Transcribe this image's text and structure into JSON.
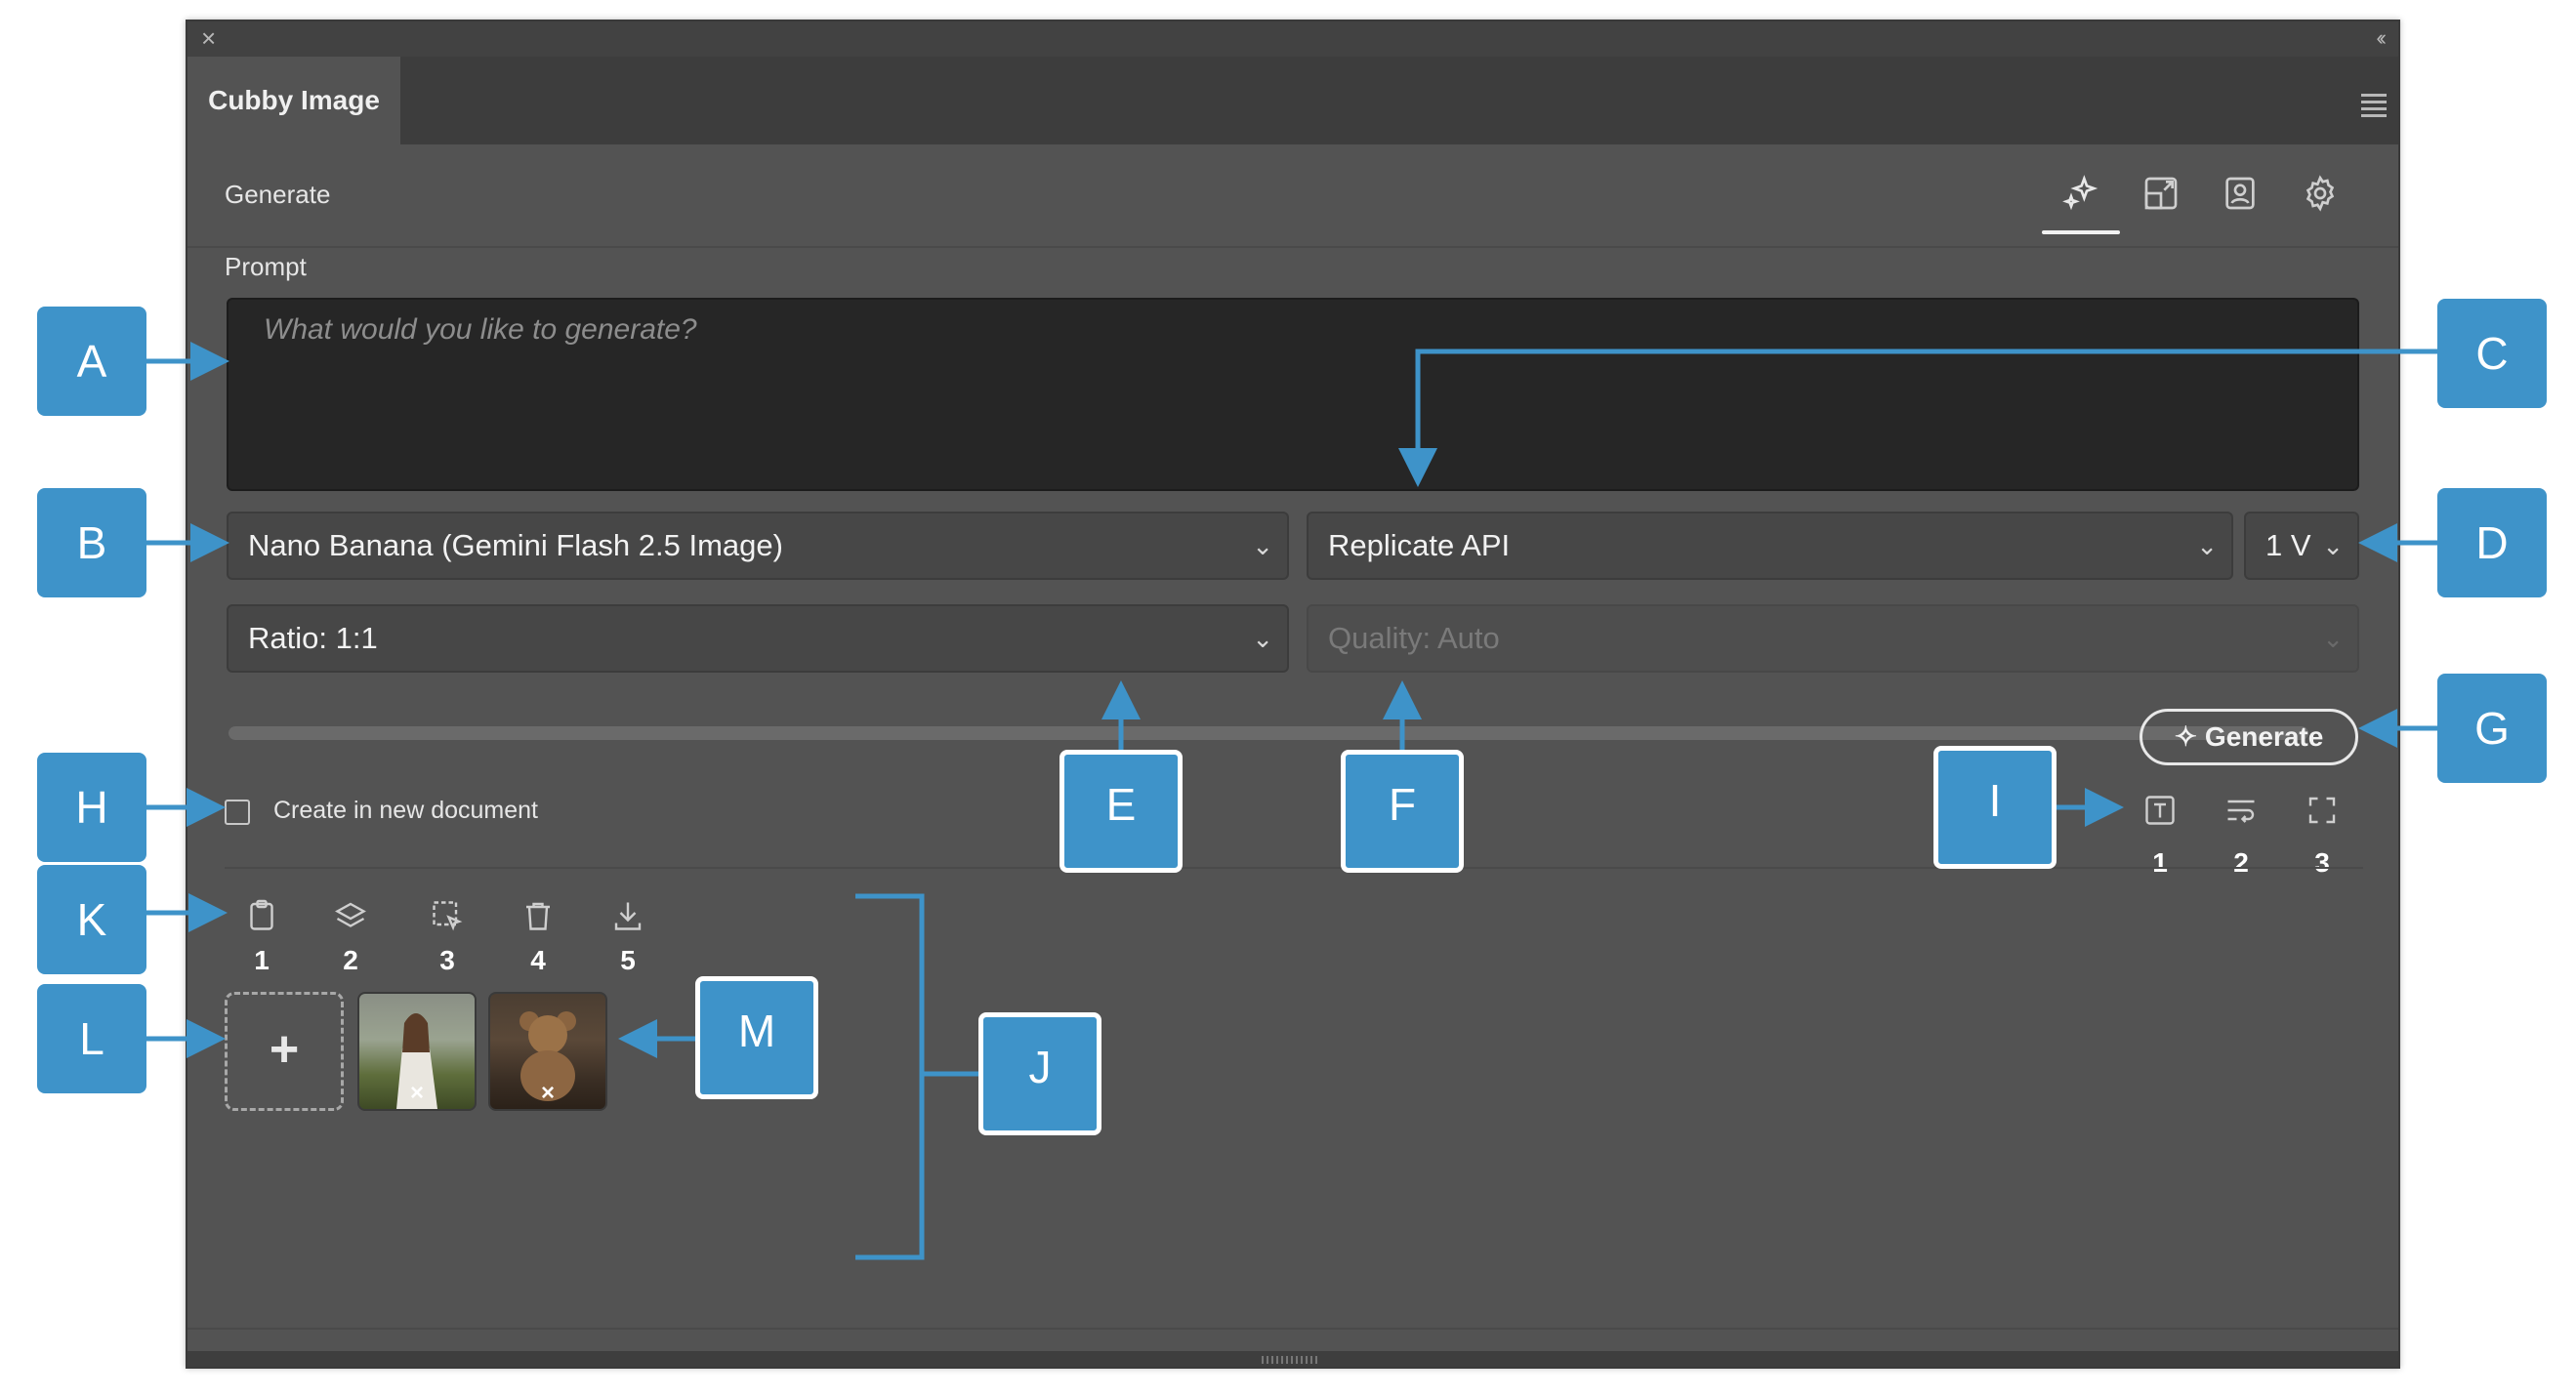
{
  "panel": {
    "close_glyph": "×",
    "collapse_glyph": "‹‹",
    "tab_label": "Cubby Image",
    "section_title": "Generate",
    "header_icons": [
      "sparkle-icon",
      "image-resize-icon",
      "portrait-icon",
      "gear-icon"
    ]
  },
  "prompt": {
    "label": "Prompt",
    "placeholder": "What would you like to generate?"
  },
  "selects": {
    "model": "Nano Banana (Gemini Flash 2.5 Image)",
    "provider": "Replicate API",
    "count": "1 V",
    "ratio": "Ratio: 1:1",
    "quality": "Quality: Auto"
  },
  "generate_button": {
    "label": "Generate",
    "icon": "sparkle-icon"
  },
  "new_document": {
    "label": "Create in new document",
    "checked": false
  },
  "output_icons": {
    "icons": [
      "text-box-icon",
      "wrap-text-icon",
      "fullscreen-icon"
    ],
    "numbers": [
      "1",
      "2",
      "3"
    ]
  },
  "toolbar": {
    "icons": [
      "clipboard-icon",
      "layers-icon",
      "select-region-icon",
      "trash-icon",
      "download-icon"
    ],
    "numbers": [
      "1",
      "2",
      "3",
      "4",
      "5"
    ]
  },
  "reference_images": {
    "add_glyph": "+",
    "remove_glyph": "×",
    "thumbnails": [
      "woman-in-field-thumbnail",
      "teddy-bear-thumbnail"
    ]
  },
  "callouts": [
    "A",
    "B",
    "C",
    "D",
    "E",
    "F",
    "G",
    "H",
    "I",
    "J",
    "K",
    "L",
    "M"
  ],
  "colors": {
    "callout": "#3e93c9",
    "panel": "#535353",
    "prompt_bg": "#262626"
  }
}
